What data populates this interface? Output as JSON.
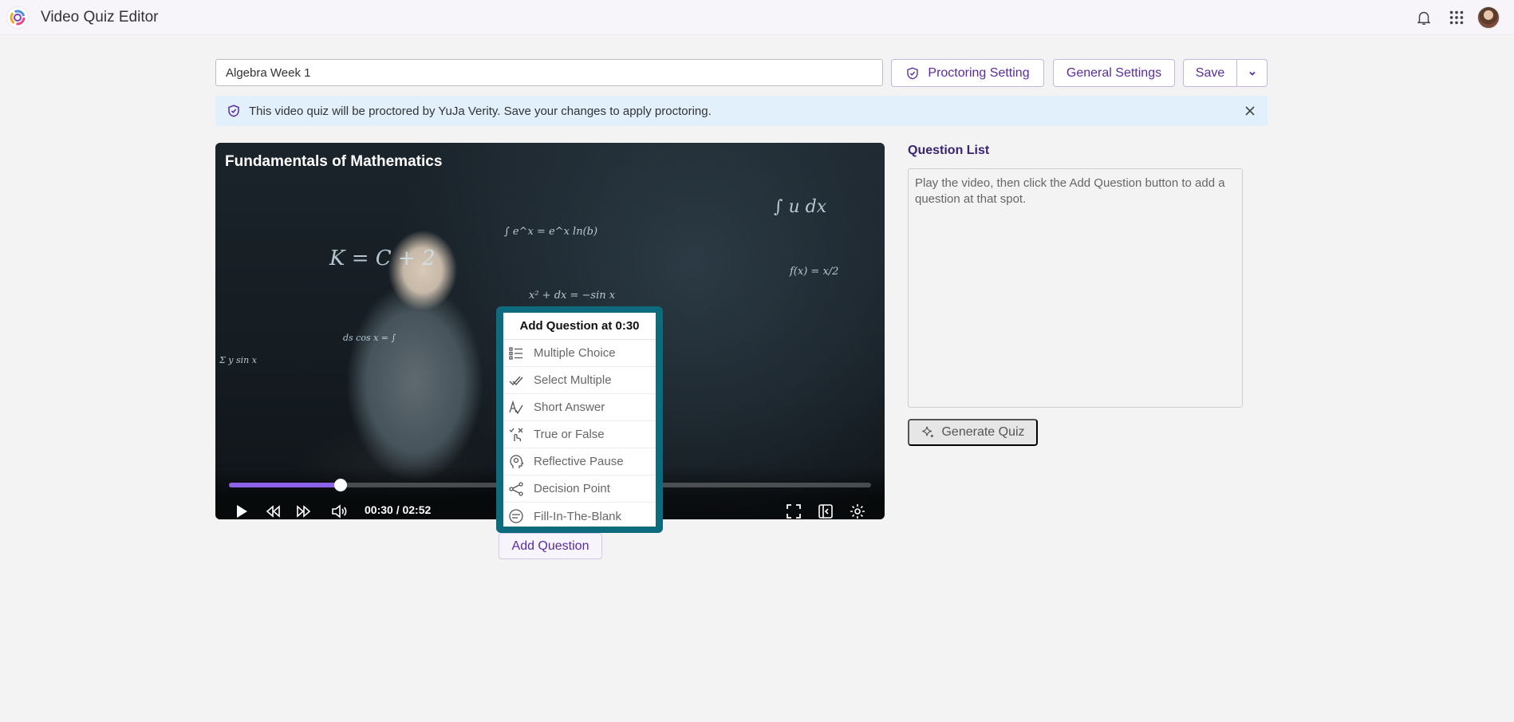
{
  "app": {
    "title": "Video Quiz Editor"
  },
  "topbar": {
    "icons": [
      "logo-icon",
      "bell-icon",
      "apps-grid-icon",
      "user-avatar"
    ]
  },
  "toolbar": {
    "quiz_title_value": "Algebra Week 1",
    "proctoring_label": "Proctoring Setting",
    "general_settings_label": "General Settings",
    "save_label": "Save"
  },
  "banner": {
    "text": "This video quiz will be proctored by YuJa Verity. Save your changes to apply proctoring."
  },
  "video": {
    "title": "Fundamentals of Mathematics",
    "time_display": "00:30 / 02:52",
    "progress_fraction": 0.1744
  },
  "add_question_menu": {
    "header": "Add Question at 0:30",
    "items": [
      {
        "label": "Multiple Choice",
        "icon": "list-icon"
      },
      {
        "label": "Select Multiple",
        "icon": "double-check-icon"
      },
      {
        "label": "Short Answer",
        "icon": "short-answer-icon"
      },
      {
        "label": "True or False",
        "icon": "true-false-icon"
      },
      {
        "label": "Reflective Pause",
        "icon": "head-thought-icon"
      },
      {
        "label": "Decision Point",
        "icon": "branch-icon"
      },
      {
        "label": "Fill-In-The-Blank",
        "icon": "fill-blank-icon"
      }
    ]
  },
  "add_question_button": {
    "label": "Add Question"
  },
  "question_list": {
    "title": "Question List",
    "empty_text": "Play the video, then click the Add Question button to add a question at that spot."
  },
  "generate_quiz": {
    "label": "Generate Quiz"
  },
  "colors": {
    "accent": "#5a2ca0",
    "progress": "#8c62e6",
    "menu_border": "#0e6a7d",
    "banner_bg": "#e2f0fb"
  }
}
